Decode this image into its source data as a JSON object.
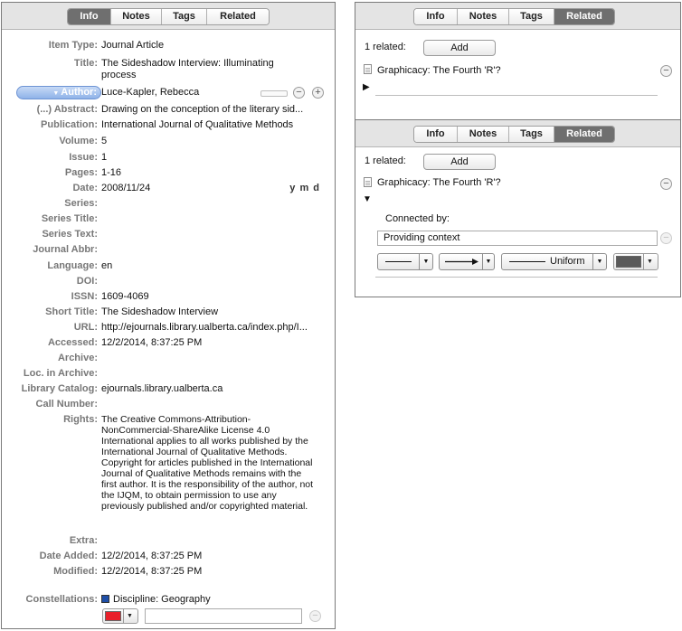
{
  "info_pane": {
    "tabs": [
      "Info",
      "Notes",
      "Tags",
      "Related"
    ],
    "active_tab": "Info",
    "fields": {
      "item_type": {
        "label": "Item Type:",
        "value": "Journal Article"
      },
      "title": {
        "label": "Title:",
        "value": "The Sideshadow Interview: Illuminating process"
      },
      "author": {
        "label": "Author:",
        "value": "Luce-Kapler, Rebecca"
      },
      "abstract": {
        "label": "(...) Abstract:",
        "value": "Drawing on the conception of the literary sid..."
      },
      "publication": {
        "label": "Publication:",
        "value": "International Journal of Qualitative Methods"
      },
      "volume": {
        "label": "Volume:",
        "value": "5"
      },
      "issue": {
        "label": "Issue:",
        "value": "1"
      },
      "pages": {
        "label": "Pages:",
        "value": "1-16"
      },
      "date": {
        "label": "Date:",
        "value": "2008/11/24",
        "format": "y m d"
      },
      "series": {
        "label": "Series:",
        "value": ""
      },
      "series_title": {
        "label": "Series Title:",
        "value": ""
      },
      "series_text": {
        "label": "Series Text:",
        "value": ""
      },
      "journal_abbr": {
        "label": "Journal Abbr:",
        "value": ""
      },
      "language": {
        "label": "Language:",
        "value": "en"
      },
      "doi": {
        "label": "DOI:",
        "value": ""
      },
      "issn": {
        "label": "ISSN:",
        "value": "1609-4069"
      },
      "short_title": {
        "label": "Short Title:",
        "value": "The Sideshadow Interview"
      },
      "url": {
        "label": "URL:",
        "value": "http://ejournals.library.ualberta.ca/index.php/I..."
      },
      "accessed": {
        "label": "Accessed:",
        "value": "12/2/2014, 8:37:25 PM"
      },
      "archive": {
        "label": "Archive:",
        "value": ""
      },
      "loc_in_archive": {
        "label": "Loc. in Archive:",
        "value": ""
      },
      "library_catalog": {
        "label": "Library Catalog:",
        "value": "ejournals.library.ualberta.ca"
      },
      "call_number": {
        "label": "Call Number:",
        "value": ""
      },
      "rights": {
        "label": "Rights:",
        "value": "The Creative Commons-Attribution-NonCommercial-ShareAlike License 4.0 International applies to all works published by the International Journal of Qualitative Methods. Copyright for articles published in the International Journal of Qualitative Methods remains with the first author. It is the responsibility of the author, not the IJQM, to obtain permission to use any previously published and/or copyrighted material."
      },
      "extra": {
        "label": "Extra:",
        "value": ""
      },
      "date_added": {
        "label": "Date Added:",
        "value": "12/2/2014, 8:37:25 PM"
      },
      "modified": {
        "label": "Modified:",
        "value": "12/2/2014, 8:37:25 PM"
      },
      "constellations": {
        "label": "Constellations:",
        "value": "Discipline: Geography",
        "swatch_color": "#1f4fa8"
      }
    },
    "new_constellation": {
      "color": "#e8202a",
      "text": ""
    }
  },
  "related_pane_1": {
    "tabs": [
      "Info",
      "Notes",
      "Tags",
      "Related"
    ],
    "active_tab": "Related",
    "count_label": "1 related:",
    "add_label": "Add",
    "items": [
      "Graphicacy: The Fourth 'R'?"
    ]
  },
  "related_pane_2": {
    "tabs": [
      "Info",
      "Notes",
      "Tags",
      "Related"
    ],
    "active_tab": "Related",
    "count_label": "1 related:",
    "add_label": "Add",
    "items": [
      "Graphicacy: The Fourth 'R'?"
    ],
    "connected_by_label": "Connected by:",
    "connection_text": "Providing context",
    "line_style_label": "Uniform",
    "line_color": "#5a5a5a"
  }
}
